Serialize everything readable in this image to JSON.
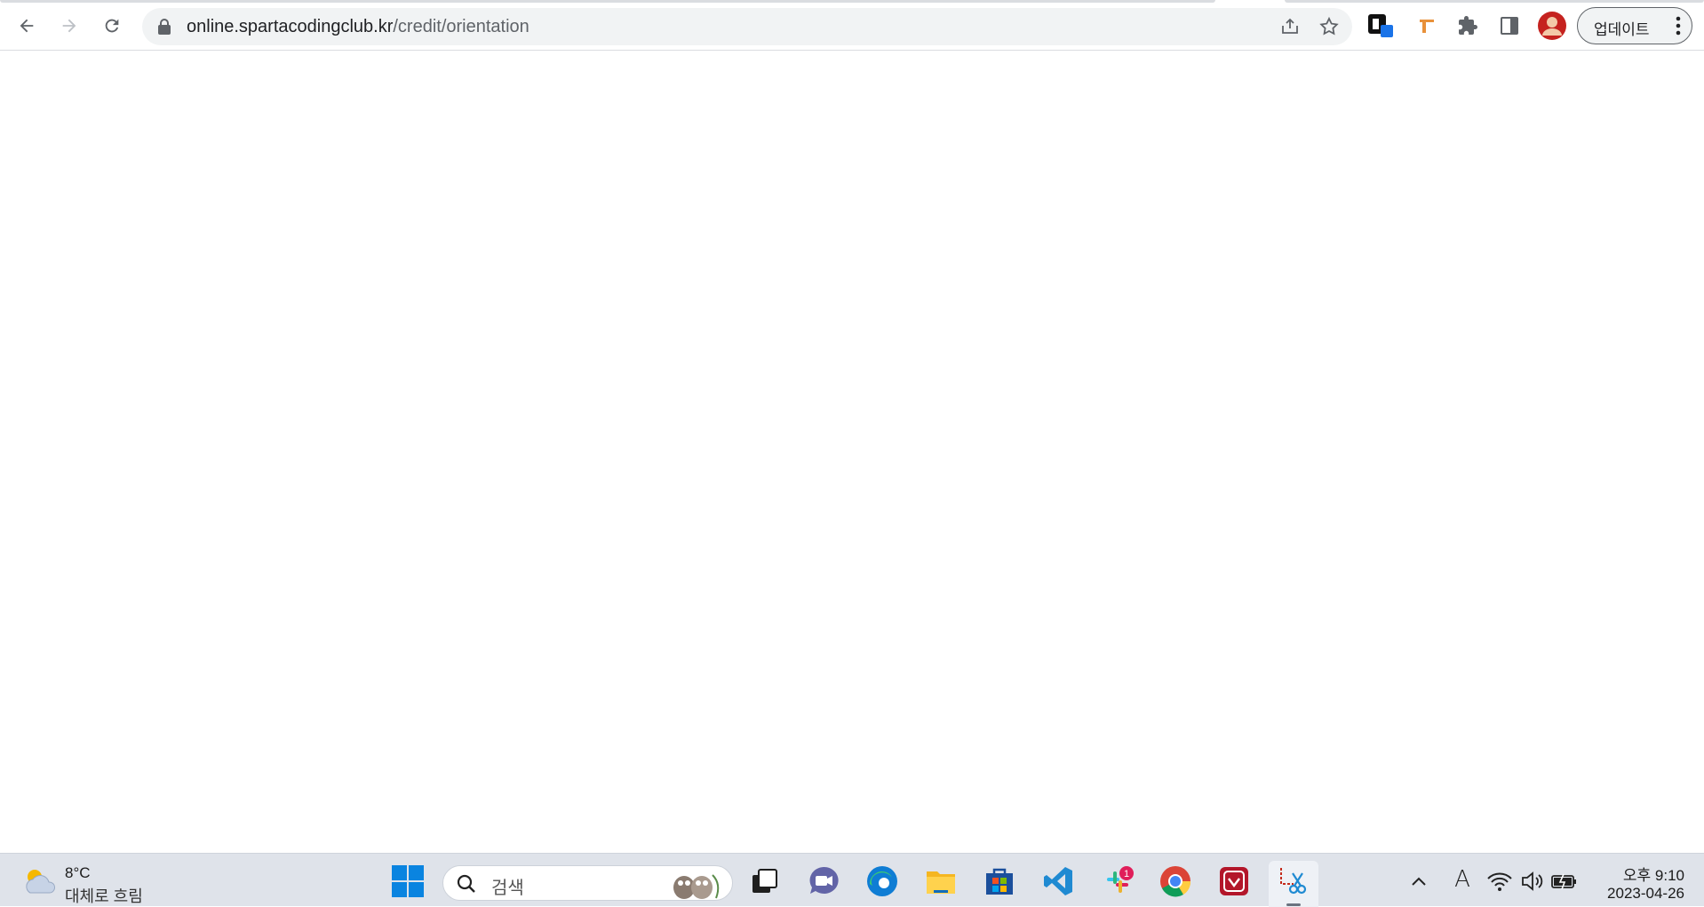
{
  "browser": {
    "url_host": "online.spartacodingclub.kr",
    "url_path": "/credit/orientation",
    "update_label": "업데이트"
  },
  "taskbar": {
    "weather_temp": "8°C",
    "weather_desc": "대체로 흐림",
    "search_placeholder": "검색",
    "slack_badge": "1",
    "clock_time": "오후 9:10",
    "clock_date": "2023-04-26",
    "ime_label": "A"
  },
  "icons": [
    "back-icon",
    "forward-icon",
    "reload-icon",
    "lock-icon",
    "share-icon",
    "star-icon",
    "extension-icon",
    "puzzle-icon",
    "sidepanel-icon",
    "profile-avatar",
    "menu-dots-icon",
    "weather-icon",
    "windows-start-icon",
    "search-icon",
    "task-view-icon",
    "teams-chat-icon",
    "edge-icon",
    "file-explorer-icon",
    "store-icon",
    "vscode-icon",
    "slack-icon",
    "chrome-icon",
    "app-icon",
    "snipping-tool-icon",
    "chevron-up-icon",
    "wifi-icon",
    "volume-icon",
    "battery-icon"
  ]
}
